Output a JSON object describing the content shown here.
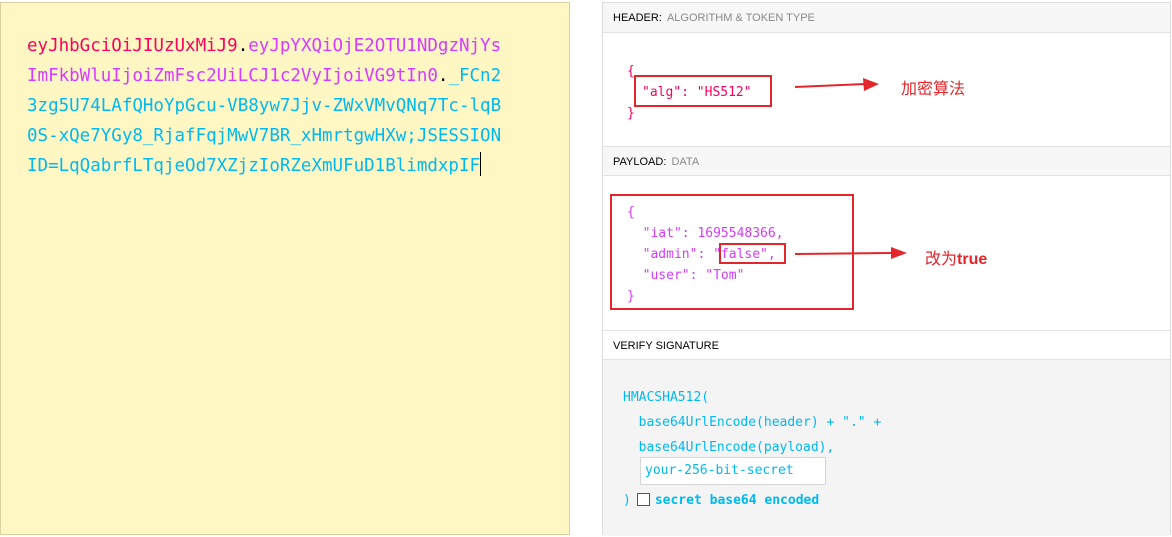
{
  "encoded": {
    "header_part": "eyJhbGciOiJIUzUxMiJ9",
    "payload_part": "eyJpYXQiOjE2OTU1NDgzNjYsImFkbWluIjoiZmFsc2UiLCJ1c2VyIjoiVG9tIn0",
    "signature_part": "_FCn23zg5U74LAfQHoYpGcu-VB8yw7Jjv-ZWxVMvQNq7Tc-lqB0S-xQe7YGy8_RjafFqjMwV7BR_xHmrtgwHXw;JSESSIONID=LqQabrfLTqjeOd7XZjzIoRZeXmUFuD1BlimdxpIF",
    "dot": "."
  },
  "header_section": {
    "title": "HEADER:",
    "subtitle": "ALGORITHM & TOKEN TYPE",
    "open_brace": "{",
    "alg_line": "\"alg\": \"HS512\"",
    "close_brace": "}",
    "annotation": "加密算法"
  },
  "payload_section": {
    "title": "PAYLOAD:",
    "subtitle": "DATA",
    "open_brace": "{",
    "iat_line": "  \"iat\": 1695548366,",
    "admin_key": "  \"admin\": ",
    "admin_value": "\"false\"",
    "admin_comma": ",",
    "user_line": "  \"user\": \"Tom\"",
    "close_brace": "}",
    "annotation_prefix": "改为",
    "annotation_bold": "true"
  },
  "verify_section": {
    "title": "VERIFY SIGNATURE",
    "line1": "HMACSHA512(",
    "line2": "  base64UrlEncode(header) + \".\" +",
    "line3": "  base64UrlEncode(payload),",
    "secret_placeholder": "your-256-bit-secret",
    "close_paren": ")",
    "checkbox_label": "secret base64 encoded"
  },
  "colors": {
    "header": "#fb015b",
    "payload": "#d63aff",
    "signature": "#00b9f1",
    "annotation": "#e3262b",
    "encoded_bg": "#fef7c3"
  }
}
